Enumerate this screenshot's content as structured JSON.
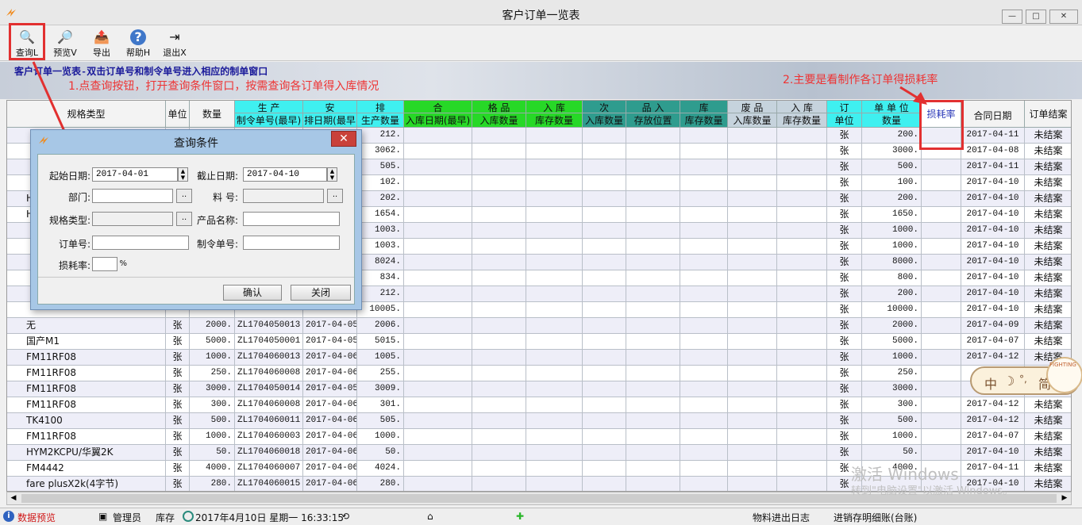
{
  "window": {
    "title": "客户订单一览表",
    "min": "—",
    "max": "□",
    "close": "✕"
  },
  "toolbar": [
    {
      "icon": "query-icon",
      "label": "查询L",
      "glyph": "🔍"
    },
    {
      "icon": "preview-icon",
      "label": "预览V",
      "glyph": "🔎"
    },
    {
      "icon": "export-icon",
      "label": "导出",
      "glyph": "📤"
    },
    {
      "icon": "help-icon",
      "label": "帮助H",
      "glyph": "?"
    },
    {
      "icon": "exit-icon",
      "label": "退出X",
      "glyph": "⇥"
    }
  ],
  "banner_text": "客户订单一览表-双击订单号和制令单号进入相应的制单窗口",
  "annotations": {
    "note1": "1.点查询按钮，打开查询条件窗口，按需查询各订单得入库情况",
    "note2": "2.主要是看制作各订单得损耗率"
  },
  "header_top": {
    "spec": "规格类型",
    "unit": "单位",
    "qty": "数量",
    "g1": "生 产",
    "g2": "安",
    "g3": "排",
    "g4": "合",
    "g5": "格 品",
    "g6": "入 库",
    "g7": "次",
    "g8": "品 入",
    "g9": "库",
    "g10": "废 品",
    "g11": "入 库",
    "g12": "订",
    "g13": "单 单 位",
    "loss": "损耗率",
    "contract": "合同日期",
    "close": "订单结案"
  },
  "header_sub": {
    "s1": "制令单号(最早)",
    "s2": "排日期(最早",
    "s3": "生产数量",
    "s4": "入库日期(最早)",
    "s5": "入库数量",
    "s6": "库存数量",
    "s7": "入库数量",
    "s8": "存放位置",
    "s9": "库存数量",
    "s10": "入库数量",
    "s11": "库存数量",
    "s12": "单位",
    "s13": "数量"
  },
  "rows": [
    {
      "spec": "",
      "unit": "",
      "qty": "",
      "order": "",
      "date": "",
      "prod": "212.",
      "ou": "张",
      "oq": "200.",
      "cdate": "2017-04-11",
      "st": "未结案"
    },
    {
      "spec": "",
      "unit": "",
      "qty": "",
      "order": "",
      "date": "",
      "prod": "3062.",
      "ou": "张",
      "oq": "3000.",
      "cdate": "2017-04-08",
      "st": "未结案"
    },
    {
      "spec": "",
      "unit": "",
      "qty": "",
      "order": "",
      "date": "",
      "prod": "505.",
      "ou": "张",
      "oq": "500.",
      "cdate": "2017-04-11",
      "st": "未结案"
    },
    {
      "spec": "",
      "unit": "",
      "qty": "",
      "order": "",
      "date": "",
      "prod": "102.",
      "ou": "张",
      "oq": "100.",
      "cdate": "2017-04-10",
      "st": "未结案"
    },
    {
      "spec": "HYM2",
      "unit": "",
      "qty": "",
      "order": "",
      "date": "",
      "prod": "202.",
      "ou": "张",
      "oq": "200.",
      "cdate": "2017-04-10",
      "st": "未结案"
    },
    {
      "spec": "HYM2",
      "unit": "",
      "qty": "",
      "order": "",
      "date": "",
      "prod": "1654.",
      "ou": "张",
      "oq": "1650.",
      "cdate": "2017-04-10",
      "st": "未结案"
    },
    {
      "spec": "",
      "unit": "",
      "qty": "",
      "order": "",
      "date": "",
      "prod": "1003.",
      "ou": "张",
      "oq": "1000.",
      "cdate": "2017-04-10",
      "st": "未结案"
    },
    {
      "spec": "",
      "unit": "",
      "qty": "",
      "order": "",
      "date": "",
      "prod": "1003.",
      "ou": "张",
      "oq": "1000.",
      "cdate": "2017-04-10",
      "st": "未结案"
    },
    {
      "spec": "",
      "unit": "",
      "qty": "",
      "order": "",
      "date": "",
      "prod": "8024.",
      "ou": "张",
      "oq": "8000.",
      "cdate": "2017-04-10",
      "st": "未结案"
    },
    {
      "spec": "",
      "unit": "",
      "qty": "",
      "order": "",
      "date": "",
      "prod": "834.",
      "ou": "张",
      "oq": "800.",
      "cdate": "2017-04-10",
      "st": "未结案"
    },
    {
      "spec": "",
      "unit": "",
      "qty": "",
      "order": "",
      "date": "",
      "prod": "212.",
      "ou": "张",
      "oq": "200.",
      "cdate": "2017-04-10",
      "st": "未结案"
    },
    {
      "spec": "",
      "unit": "",
      "qty": "",
      "order": "",
      "date": "",
      "prod": "10005.",
      "ou": "张",
      "oq": "10000.",
      "cdate": "2017-04-10",
      "st": "未结案"
    },
    {
      "spec": "无",
      "unit": "张",
      "qty": "2000.",
      "order": "ZL1704050013",
      "date": "2017-04-05",
      "prod": "2006.",
      "ou": "张",
      "oq": "2000.",
      "cdate": "2017-04-09",
      "st": "未结案"
    },
    {
      "spec": "国产M1",
      "unit": "张",
      "qty": "5000.",
      "order": "ZL1704050001",
      "date": "2017-04-05",
      "prod": "5015.",
      "ou": "张",
      "oq": "5000.",
      "cdate": "2017-04-07",
      "st": "未结案"
    },
    {
      "spec": "FM11RF08",
      "unit": "张",
      "qty": "1000.",
      "order": "ZL1704060013",
      "date": "2017-04-06",
      "prod": "1005.",
      "ou": "张",
      "oq": "1000.",
      "cdate": "2017-04-12",
      "st": "未结案"
    },
    {
      "spec": "FM11RF08",
      "unit": "张",
      "qty": "250.",
      "order": "ZL1704060008",
      "date": "2017-04-06",
      "prod": "255.",
      "ou": "张",
      "oq": "250.",
      "cdate": "",
      "st": ""
    },
    {
      "spec": "FM11RF08",
      "unit": "张",
      "qty": "3000.",
      "order": "ZL1704050014",
      "date": "2017-04-05",
      "prod": "3009.",
      "ou": "张",
      "oq": "3000.",
      "cdate": "",
      "st": ""
    },
    {
      "spec": "FM11RF08",
      "unit": "张",
      "qty": "300.",
      "order": "ZL1704060008",
      "date": "2017-04-06",
      "prod": "301.",
      "ou": "张",
      "oq": "300.",
      "cdate": "2017-04-12",
      "st": "未结案"
    },
    {
      "spec": "TK4100",
      "unit": "张",
      "qty": "500.",
      "order": "ZL1704060011",
      "date": "2017-04-06",
      "prod": "505.",
      "ou": "张",
      "oq": "500.",
      "cdate": "2017-04-12",
      "st": "未结案"
    },
    {
      "spec": "FM11RF08",
      "unit": "张",
      "qty": "1000.",
      "order": "ZL1704060003",
      "date": "2017-04-06",
      "prod": "1000.",
      "ou": "张",
      "oq": "1000.",
      "cdate": "2017-04-07",
      "st": "未结案"
    },
    {
      "spec": "HYM2KCPU/华翼2K",
      "unit": "张",
      "qty": "50.",
      "order": "ZL1704060018",
      "date": "2017-04-06",
      "prod": "50.",
      "ou": "张",
      "oq": "50.",
      "cdate": "2017-04-10",
      "st": "未结案"
    },
    {
      "spec": "FM4442",
      "unit": "张",
      "qty": "4000.",
      "order": "ZL1704060007",
      "date": "2017-04-06",
      "prod": "4024.",
      "ou": "张",
      "oq": "4000.",
      "cdate": "2017-04-11",
      "st": "未结案"
    },
    {
      "spec": "fare plusX2k(4字节)",
      "unit": "张",
      "qty": "280.",
      "order": "ZL1704060015",
      "date": "2017-04-06",
      "prod": "280.",
      "ou": "张",
      "oq": "",
      "cdate": "2017-04-10",
      "st": "未结案"
    }
  ],
  "dialog": {
    "title": "查询条件",
    "close": "✕",
    "start_label": "起始日期:",
    "start_value": "2017-04-01",
    "end_label": "截止日期:",
    "end_value": "2017-04-10",
    "dept_label": "部门:",
    "item_label": "料 号:",
    "spec_label": "规格类型:",
    "product_label": "产品名称:",
    "order_label": "订单号:",
    "make_label": "制令单号:",
    "loss_label": "损耗率:",
    "percent": "%",
    "ellipsis": "..",
    "ok": "确认",
    "cancel": "关闭"
  },
  "ime": {
    "text": "中",
    "moon": "☽",
    "dot": "°,",
    "jian": "简",
    "fighting": "FIGHTING"
  },
  "watermark": {
    "line1": "激活 Windows",
    "line2": "转到\"电脑设置\"以激活 Windows。"
  },
  "status": {
    "preview": "数据预览",
    "user": "管理员",
    "store": "库存",
    "datetime": "2017年4月10日 星期一 16:33:15",
    "log": "物料进出日志",
    "detail": "进销存明细账(台账)"
  },
  "scroll": {
    "left": "◀",
    "right": "▶"
  }
}
